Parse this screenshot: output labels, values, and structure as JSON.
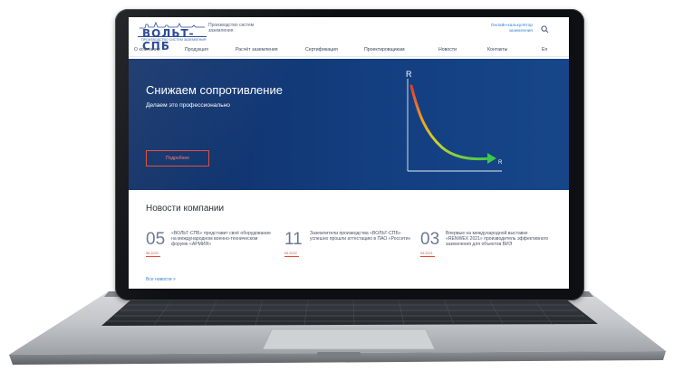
{
  "header": {
    "logo_text": "ВОЛЬТ-СПБ",
    "logo_subtext": "ПРОИЗВОДСТВО СИСТЕМ ЗАЗЕМЛЕНИЯ",
    "tagline": "Производство систем заземления",
    "calculator_link": "Онлайн-калькулятор заземления"
  },
  "nav": {
    "items": [
      "О компании",
      "Продукция",
      "Расчёт заземления",
      "Сертификация",
      "Проектировщикам",
      "Новости",
      "Контакты",
      "En"
    ]
  },
  "hero": {
    "title": "Снижаем сопротивление",
    "subtitle": "Делаем это профессионально",
    "button_label": "Подробнее",
    "chart_y_label": "R",
    "chart_x_label": "R"
  },
  "news": {
    "title": "Новости компании",
    "items": [
      {
        "day": "05",
        "date": "08.2022",
        "text": "«ВОЛЬТ-СПБ» представит своё оборудование на международном военно-техническом форуме «АРМИЯ»"
      },
      {
        "day": "11",
        "date": "05.2022",
        "text": "Заземлители производства «ВОЛЬТ-СПБ» успешно прошли аттестацию в ПАО «Россети»"
      },
      {
        "day": "03",
        "date": "04.2021",
        "text": "Впервые на международной выставке «RENWEX 2021» производитель эффективного заземления для объектов ВИЭ"
      }
    ],
    "all_news_link": "Все новости  >"
  },
  "colors": {
    "brand_blue": "#1d3f8f",
    "hero_bg": "#133e80",
    "accent_red": "#e04a3a",
    "link_blue": "#2f7fd6"
  }
}
